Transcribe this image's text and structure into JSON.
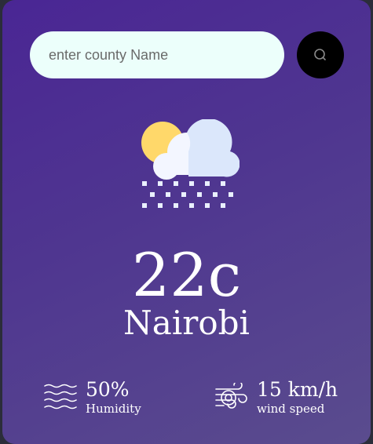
{
  "search": {
    "placeholder": "enter county Name",
    "icon": "search-icon"
  },
  "weather": {
    "icon": "cloud-sun-snow-icon",
    "temperature": "22c",
    "city": "Nairobi"
  },
  "details": {
    "humidity": {
      "value": "50%",
      "label": "Humidity",
      "icon": "humidity-waves-icon"
    },
    "wind": {
      "value": "15 km/h",
      "label": "wind speed",
      "icon": "wind-icon"
    }
  },
  "colors": {
    "card_top": "#4a2694",
    "card_bottom": "#5a4c8e",
    "input_bg": "#ecfffb",
    "button_bg": "#000000"
  }
}
